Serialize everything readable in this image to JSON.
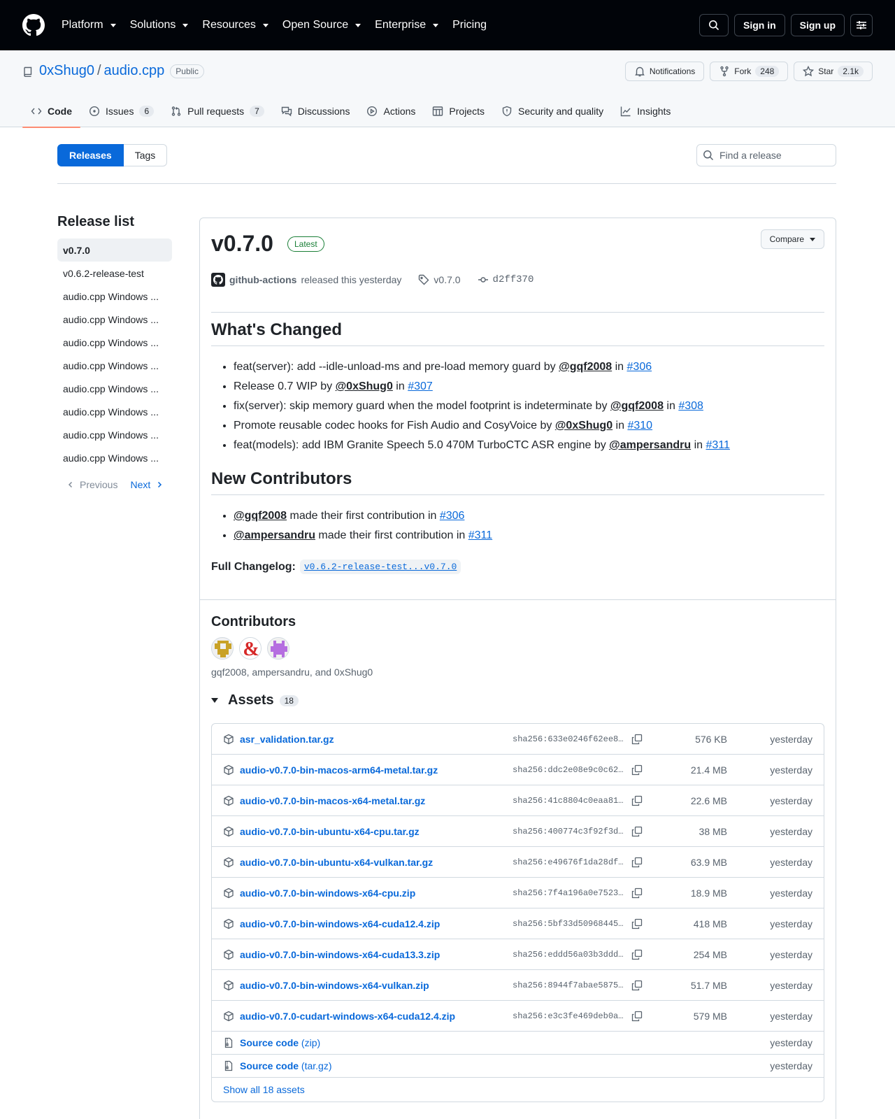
{
  "header": {
    "nav": [
      "Platform",
      "Solutions",
      "Resources",
      "Open Source",
      "Enterprise",
      "Pricing"
    ],
    "nav_has_caret": [
      true,
      true,
      true,
      true,
      true,
      false
    ],
    "sign_in": "Sign in",
    "sign_up": "Sign up"
  },
  "repo": {
    "owner": "0xShug0",
    "sep": "/",
    "name": "audio.cpp",
    "visibility": "Public",
    "notifications": "Notifications",
    "fork_label": "Fork",
    "fork_count": "248",
    "star_label": "Star",
    "star_count": "2.1k"
  },
  "tabs": [
    {
      "label": "Code",
      "icon": "code-icon",
      "counter": ""
    },
    {
      "label": "Issues",
      "icon": "issue-icon",
      "counter": "6"
    },
    {
      "label": "Pull requests",
      "icon": "pull-request-icon",
      "counter": "7"
    },
    {
      "label": "Discussions",
      "icon": "discussions-icon",
      "counter": ""
    },
    {
      "label": "Actions",
      "icon": "actions-icon",
      "counter": ""
    },
    {
      "label": "Projects",
      "icon": "projects-icon",
      "counter": ""
    },
    {
      "label": "Security and quality",
      "icon": "shield-icon",
      "counter": ""
    },
    {
      "label": "Insights",
      "icon": "graph-icon",
      "counter": ""
    }
  ],
  "subnav": {
    "releases": "Releases",
    "tags": "Tags",
    "find_placeholder": "Find a release"
  },
  "sidebar": {
    "title": "Release list",
    "items": [
      "v0.7.0",
      "v0.6.2-release-test",
      "audio.cpp Windows ...",
      "audio.cpp Windows ...",
      "audio.cpp Windows ...",
      "audio.cpp Windows ...",
      "audio.cpp Windows ...",
      "audio.cpp Windows ...",
      "audio.cpp Windows ...",
      "audio.cpp Windows ..."
    ],
    "previous": "Previous",
    "next": "Next"
  },
  "release": {
    "version": "v0.7.0",
    "latest": "Latest",
    "compare": "Compare",
    "author": "github-actions",
    "released_text": "released this yesterday",
    "tag": "v0.7.0",
    "commit": "d2ff370",
    "whats_changed": "What's Changed",
    "changes": [
      {
        "text": "feat(server): add --idle-unload-ms and pre-load memory guard by ",
        "user": "@gqf2008",
        "in": " in ",
        "pr": "#306"
      },
      {
        "text": "Release 0.7 WIP by ",
        "user": "@0xShug0",
        "in": " in ",
        "pr": "#307"
      },
      {
        "text": "fix(server): skip memory guard when the model footprint is indeterminate by ",
        "user": "@gqf2008",
        "in": " in ",
        "pr": "#308"
      },
      {
        "text": "Promote reusable codec hooks for Fish Audio and CosyVoice by ",
        "user": "@0xShug0",
        "in": " in ",
        "pr": "#310"
      },
      {
        "text": "feat(models): add IBM Granite Speech 5.0 470M TurboCTC ASR engine by ",
        "user": "@ampersandru",
        "in": " in ",
        "pr": "#311"
      }
    ],
    "new_contributors": "New Contributors",
    "contributors_list": [
      {
        "user": "@gqf2008",
        "text": " made their first contribution in ",
        "pr": "#306"
      },
      {
        "user": "@ampersandru",
        "text": " made their first contribution in ",
        "pr": "#311"
      }
    ],
    "full_changelog_label": "Full Changelog:",
    "full_changelog_link": "v0.6.2-release-test...v0.7.0",
    "contributors_title": "Contributors",
    "contributors_names": "gqf2008, ampersandru, and 0xShug0",
    "assets_title": "Assets",
    "assets_count": "18",
    "assets": [
      {
        "name": "asr_validation.tar.gz",
        "sha": "sha256:633e0246f62ee8…",
        "size": "576 KB",
        "date": "yesterday"
      },
      {
        "name": "audio-v0.7.0-bin-macos-arm64-metal.tar.gz",
        "sha": "sha256:ddc2e08e9c0c62…",
        "size": "21.4 MB",
        "date": "yesterday"
      },
      {
        "name": "audio-v0.7.0-bin-macos-x64-metal.tar.gz",
        "sha": "sha256:41c8804c0eaa81…",
        "size": "22.6 MB",
        "date": "yesterday"
      },
      {
        "name": "audio-v0.7.0-bin-ubuntu-x64-cpu.tar.gz",
        "sha": "sha256:400774c3f92f3d…",
        "size": "38 MB",
        "date": "yesterday"
      },
      {
        "name": "audio-v0.7.0-bin-ubuntu-x64-vulkan.tar.gz",
        "sha": "sha256:e49676f1da28df…",
        "size": "63.9 MB",
        "date": "yesterday"
      },
      {
        "name": "audio-v0.7.0-bin-windows-x64-cpu.zip",
        "sha": "sha256:7f4a196a0e7523…",
        "size": "18.9 MB",
        "date": "yesterday"
      },
      {
        "name": "audio-v0.7.0-bin-windows-x64-cuda12.4.zip",
        "sha": "sha256:5bf33d50968445…",
        "size": "418 MB",
        "date": "yesterday"
      },
      {
        "name": "audio-v0.7.0-bin-windows-x64-cuda13.3.zip",
        "sha": "sha256:eddd56a03b3ddd…",
        "size": "254 MB",
        "date": "yesterday"
      },
      {
        "name": "audio-v0.7.0-bin-windows-x64-vulkan.zip",
        "sha": "sha256:8944f7abae5875…",
        "size": "51.7 MB",
        "date": "yesterday"
      },
      {
        "name": "audio-v0.7.0-cudart-windows-x64-cuda12.4.zip",
        "sha": "sha256:e3c3fe469deb0a…",
        "size": "579 MB",
        "date": "yesterday"
      }
    ],
    "source_zip": {
      "name": "Source code",
      "suffix": "(zip)",
      "date": "yesterday"
    },
    "source_tar": {
      "name": "Source code",
      "suffix": "(tar.gz)",
      "date": "yesterday"
    },
    "show_all": "Show all 18 assets"
  },
  "colors": {
    "accent": "#0969da",
    "header_bg": "#010409",
    "latest_green": "#1a7f37",
    "tab_underline": "#fd8c73"
  }
}
